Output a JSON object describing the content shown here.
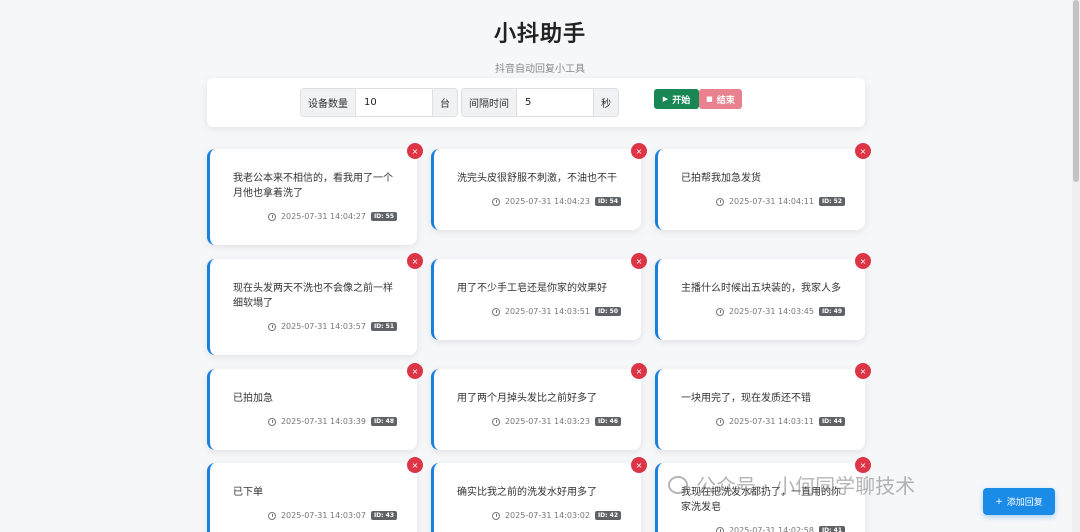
{
  "header": {
    "title": "小抖助手",
    "subtitle": "抖音自动回复小工具"
  },
  "controls": {
    "device_label": "设备数量",
    "device_value": "10",
    "device_unit": "台",
    "interval_label": "间隔时间",
    "interval_value": "5",
    "interval_unit": "秒",
    "start_label": "开始",
    "stop_label": "结束"
  },
  "cards": [
    {
      "text": "我老公本来不相信的，看我用了一个月他也拿着洗了",
      "time": "2025-07-31 14:04:27",
      "id": "ID: 55"
    },
    {
      "text": "洗完头皮很舒服不刺激，不油也不干",
      "time": "2025-07-31 14:04:23",
      "id": "ID: 54"
    },
    {
      "text": "已拍帮我加急发货",
      "time": "2025-07-31 14:04:11",
      "id": "ID: 52"
    },
    {
      "text": "现在头发两天不洗也不会像之前一样细软塌了",
      "time": "2025-07-31 14:03:57",
      "id": "ID: 51"
    },
    {
      "text": "用了不少手工皂还是你家的效果好",
      "time": "2025-07-31 14:03:51",
      "id": "ID: 50"
    },
    {
      "text": "主播什么时候出五块装的，我家人多",
      "time": "2025-07-31 14:03:45",
      "id": "ID: 49"
    },
    {
      "text": "已拍加急",
      "time": "2025-07-31 14:03:39",
      "id": "ID: 48"
    },
    {
      "text": "用了两个月掉头发比之前好多了",
      "time": "2025-07-31 14:03:23",
      "id": "ID: 46"
    },
    {
      "text": "一块用完了，现在发质还不错",
      "time": "2025-07-31 14:03:11",
      "id": "ID: 44"
    },
    {
      "text": "已下单",
      "time": "2025-07-31 14:03:07",
      "id": "ID: 43"
    },
    {
      "text": "确实比我之前的洗发水好用多了",
      "time": "2025-07-31 14:03:02",
      "id": "ID: 42"
    },
    {
      "text": "我现在把洗发水都扔了，一直用的你家洗发皂",
      "time": "2025-07-31 14:02:58",
      "id": "ID: 41"
    }
  ],
  "add_button_label": "添加回复",
  "watermark": "公众号 · 小何同学聊技术",
  "icons": {
    "delete": "close-icon",
    "time": "clock-icon",
    "start": "play-icon",
    "stop": "stop-icon",
    "add": "plus-icon"
  }
}
